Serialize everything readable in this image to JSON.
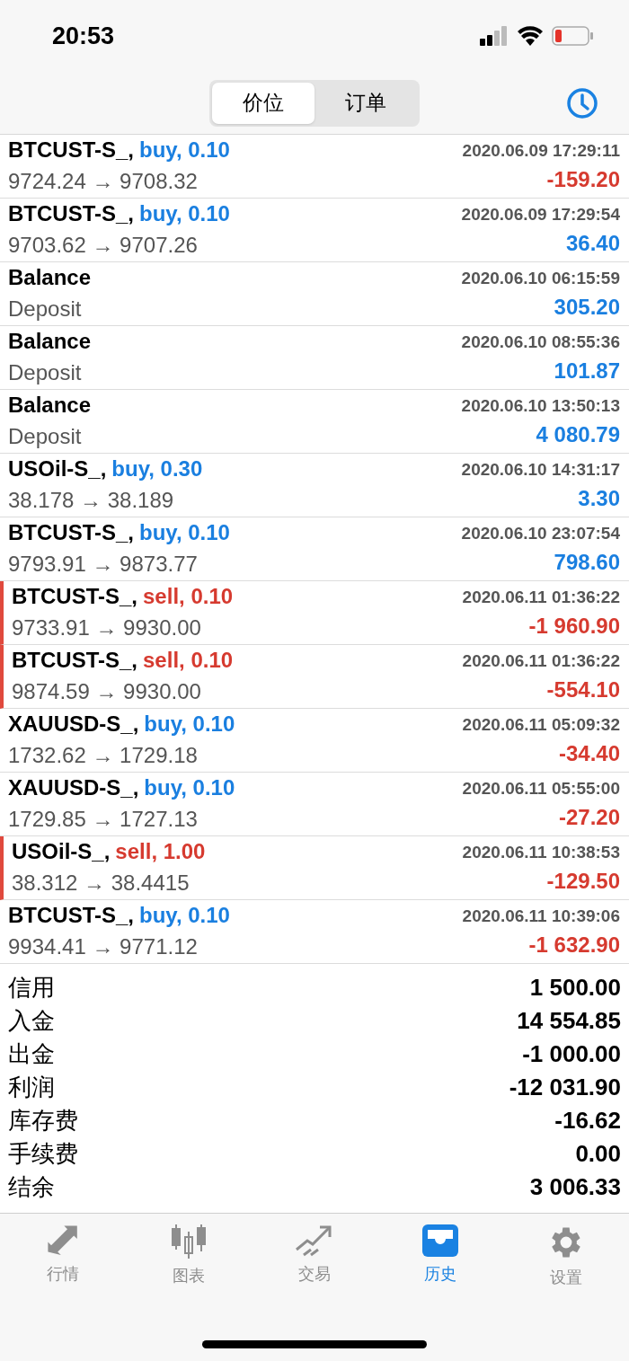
{
  "status_bar": {
    "time": "20:53"
  },
  "segments": [
    {
      "label": "价位",
      "selected": true
    },
    {
      "label": "订单",
      "selected": false
    }
  ],
  "deals": [
    {
      "symbol": "BTCUST-S_,",
      "kind": "buy",
      "side": "buy, 0.10",
      "time": "2020.06.09 17:29:11",
      "prices": "9724.24 → 9708.32",
      "profit": "-159.20",
      "loss": true
    },
    {
      "symbol": "BTCUST-S_,",
      "kind": "buy",
      "side": "buy, 0.10",
      "time": "2020.06.09 17:29:54",
      "prices": "9703.62 → 9707.26",
      "profit": "36.40",
      "loss": false
    },
    {
      "symbol": "Balance",
      "kind": "balance",
      "time": "2020.06.10 06:15:59",
      "prices": "Deposit",
      "profit": "305.20",
      "loss": false
    },
    {
      "symbol": "Balance",
      "kind": "balance",
      "time": "2020.06.10 08:55:36",
      "prices": "Deposit",
      "profit": "101.87",
      "loss": false
    },
    {
      "symbol": "Balance",
      "kind": "balance",
      "time": "2020.06.10 13:50:13",
      "prices": "Deposit",
      "profit": "4 080.79",
      "loss": false
    },
    {
      "symbol": "USOil-S_,",
      "kind": "buy",
      "side": "buy, 0.30",
      "time": "2020.06.10 14:31:17",
      "prices": "38.178 → 38.189",
      "profit": "3.30",
      "loss": false
    },
    {
      "symbol": "BTCUST-S_,",
      "kind": "buy",
      "side": "buy, 0.10",
      "time": "2020.06.10 23:07:54",
      "prices": "9793.91 → 9873.77",
      "profit": "798.60",
      "loss": false
    },
    {
      "symbol": "BTCUST-S_,",
      "kind": "sell",
      "side": "sell, 0.10",
      "time": "2020.06.11 01:36:22",
      "prices": "9733.91 → 9930.00",
      "profit": "-1 960.90",
      "loss": true
    },
    {
      "symbol": "BTCUST-S_,",
      "kind": "sell",
      "side": "sell, 0.10",
      "time": "2020.06.11 01:36:22",
      "prices": "9874.59 → 9930.00",
      "profit": "-554.10",
      "loss": true
    },
    {
      "symbol": "XAUUSD-S_,",
      "kind": "buy",
      "side": "buy, 0.10",
      "time": "2020.06.11 05:09:32",
      "prices": "1732.62 → 1729.18",
      "profit": "-34.40",
      "loss": true
    },
    {
      "symbol": "XAUUSD-S_,",
      "kind": "buy",
      "side": "buy, 0.10",
      "time": "2020.06.11 05:55:00",
      "prices": "1729.85 → 1727.13",
      "profit": "-27.20",
      "loss": true
    },
    {
      "symbol": "USOil-S_,",
      "kind": "sell",
      "side": "sell, 1.00",
      "time": "2020.06.11 10:38:53",
      "prices": "38.312 → 38.4415",
      "profit": "-129.50",
      "loss": true
    },
    {
      "symbol": "BTCUST-S_,",
      "kind": "buy",
      "side": "buy, 0.10",
      "time": "2020.06.11 10:39:06",
      "prices": "9934.41 → 9771.12",
      "profit": "-1 632.90",
      "loss": true
    }
  ],
  "summary": [
    {
      "label": "信用",
      "value": "1 500.00"
    },
    {
      "label": "入金",
      "value": "14 554.85"
    },
    {
      "label": "出金",
      "value": "-1 000.00"
    },
    {
      "label": "利润",
      "value": "-12 031.90"
    },
    {
      "label": "库存费",
      "value": "-16.62"
    },
    {
      "label": "手续费",
      "value": "0.00"
    },
    {
      "label": "结余",
      "value": "3 006.33"
    }
  ],
  "tab_bar": [
    {
      "label": "行情",
      "kind": "quotes",
      "selected": false
    },
    {
      "label": "图表",
      "kind": "chart",
      "selected": false
    },
    {
      "label": "交易",
      "kind": "trade",
      "selected": false
    },
    {
      "label": "历史",
      "kind": "history",
      "selected": true
    },
    {
      "label": "设置",
      "kind": "settings",
      "selected": false
    }
  ]
}
